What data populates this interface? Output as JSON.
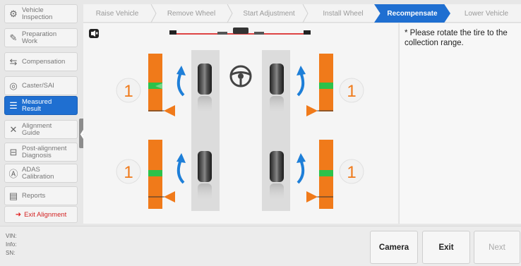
{
  "sidebar": {
    "items": [
      {
        "label": "Vehicle\nInspection",
        "icon": "vehicle-inspection-icon",
        "glyph": "⚙"
      },
      {
        "label": "Preparation\nWork",
        "icon": "wrench-icon",
        "glyph": "🔧"
      },
      {
        "label": "Compensation",
        "icon": "compensation-icon",
        "glyph": "⇆"
      },
      {
        "label": "Caster/SAI",
        "icon": "steering-wheel-icon",
        "glyph": "◎"
      },
      {
        "label": "Measured\nResult",
        "icon": "list-icon",
        "glyph": "☰"
      },
      {
        "label": "Alignment\nGuide",
        "icon": "tools-icon",
        "glyph": "✕"
      },
      {
        "label": "Post-alignment\nDiagnosis",
        "icon": "car-icon",
        "glyph": "⊟"
      },
      {
        "label": "ADAS\nCalibration",
        "icon": "adas-icon",
        "glyph": "Ⓐ"
      },
      {
        "label": "Reports",
        "icon": "report-icon",
        "glyph": "▤"
      }
    ],
    "active_index": 4,
    "exit_label": "Exit Alignment"
  },
  "steps": [
    "Raise Vehicle",
    "Remove Wheel",
    "Start Adjustment",
    "Install Wheel",
    "Recompensate",
    "Lower Vehicle"
  ],
  "active_step": 4,
  "main": {
    "wheel_numbers": [
      "1",
      "1",
      "1",
      "1"
    ],
    "sound_icon": "mute-icon"
  },
  "info": {
    "text": "* Please rotate the tire to the collection range."
  },
  "bottom": {
    "vin_label": "VIN:",
    "info_label": "Info:",
    "sn_label": "SN:",
    "camera_label": "Camera",
    "exit_label": "Exit",
    "next_label": "Next"
  },
  "colors": {
    "accent": "#1f6fd1",
    "orange": "#f07a1a",
    "green": "#2cc24a",
    "arrow_blue": "#1e7fd8"
  }
}
